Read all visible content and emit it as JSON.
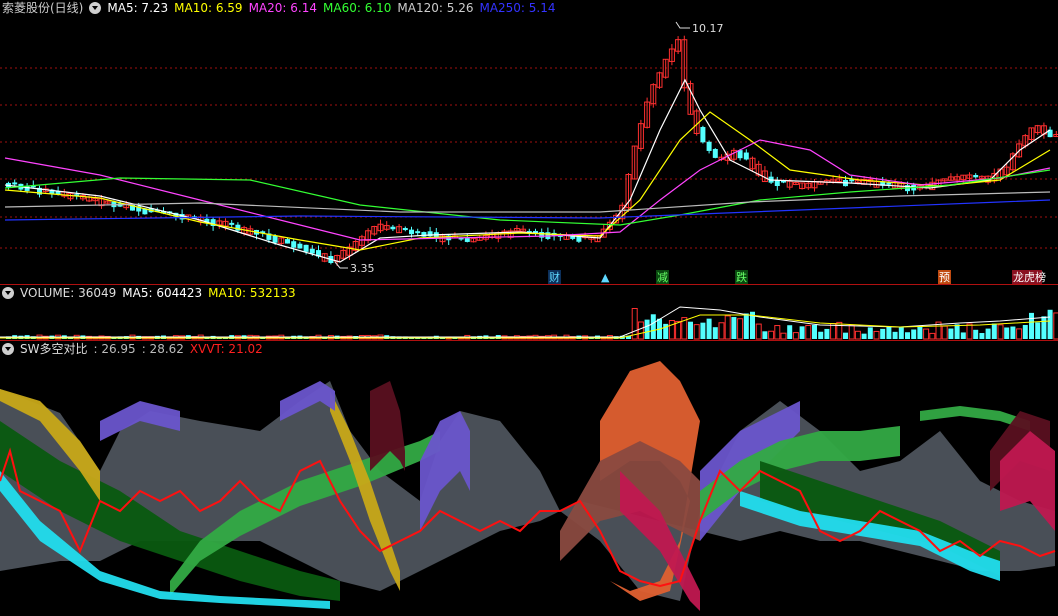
{
  "price_pane": {
    "stock_name": "索菱股份(日线)",
    "indicators": [
      {
        "label": "MA5: 7.23",
        "color": "#ffffff"
      },
      {
        "label": "MA10: 6.59",
        "color": "#ffff00"
      },
      {
        "label": "MA20: 6.14",
        "color": "#ff44ff"
      },
      {
        "label": "MA60: 6.10",
        "color": "#33ff33"
      },
      {
        "label": "MA120: 5.26",
        "color": "#cccccc"
      },
      {
        "label": "MA250: 5.14",
        "color": "#3333ff"
      }
    ],
    "high_label": "10.17",
    "low_label": "3.35",
    "events": [
      {
        "text": "财",
        "color": "#5fd7ff",
        "bg": "#0c2f5a"
      },
      {
        "text": "▲",
        "color": "#5fd7ff",
        "bg": "#000000"
      },
      {
        "text": "减",
        "color": "#66ff66",
        "bg": "#0a4a10"
      },
      {
        "text": "跌",
        "color": "#66ff66",
        "bg": "#0a4a10"
      },
      {
        "text": "预",
        "color": "#ffffff",
        "bg": "#c04a10"
      },
      {
        "text": "龙虎榜",
        "color": "#ffffff",
        "bg": "#8a1020"
      }
    ]
  },
  "volume_pane": {
    "indicators": [
      {
        "label": "VOLUME: 36049",
        "color": "#dddddd"
      },
      {
        "label": "MA5: 604423",
        "color": "#ffffff"
      },
      {
        "label": "MA10: 532133",
        "color": "#ffff00"
      }
    ]
  },
  "sw_pane": {
    "title": "SW多空对比",
    "indicators": [
      {
        "label": ": 26.95",
        "color": "#bbbbbb"
      },
      {
        "label": ": 28.62",
        "color": "#bbbbbb"
      },
      {
        "label": "XVVT: 21.02",
        "color": "#ff2020"
      }
    ]
  },
  "colors": {
    "up": "#ff3030",
    "down": "#54ffff",
    "grid": "#a01010",
    "sw_line": "#ff1010"
  }
}
